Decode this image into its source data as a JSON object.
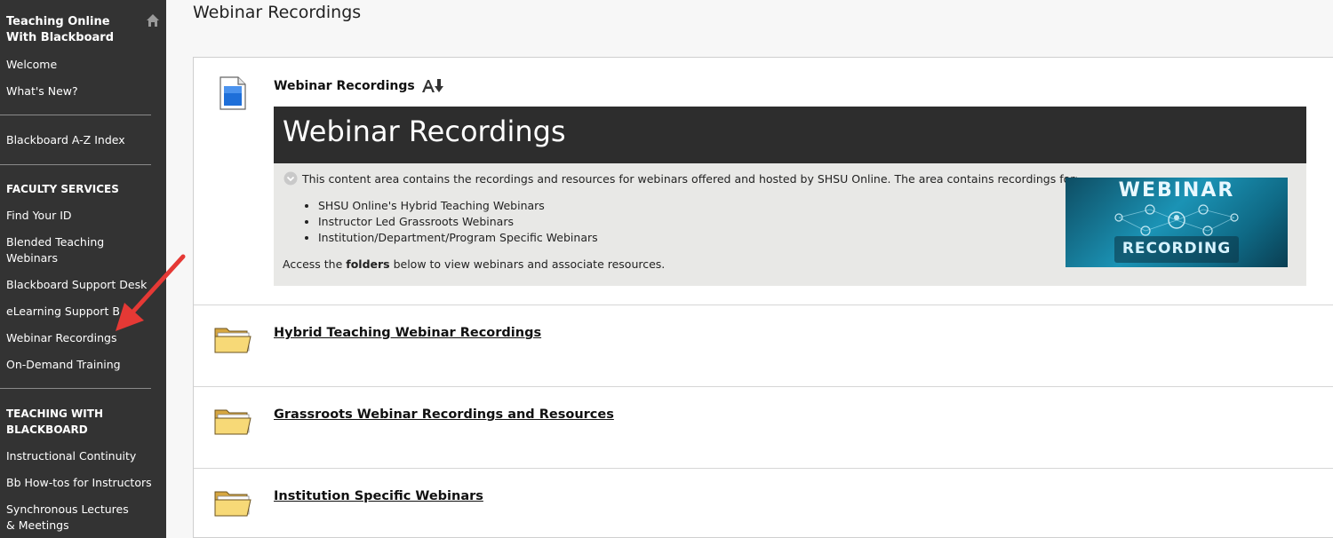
{
  "sidebar": {
    "course_title": "Teaching Online With Blackboard",
    "items_top": [
      "Welcome",
      "What's New?"
    ],
    "item_az": "Blackboard A-Z Index",
    "heading_faculty": "FACULTY SERVICES",
    "faculty_items": [
      "Find Your ID",
      "Blended Teaching Webinars",
      "Blackboard Support Desk",
      "eLearning Support B",
      "Webinar Recordings",
      "On-Demand Training"
    ],
    "heading_teaching": "TEACHING WITH BLACKBOARD",
    "teaching_items": [
      "Instructional Continuity",
      "Bb How-tos for Instructors",
      "Synchronous Lectures & Meetings"
    ]
  },
  "main": {
    "page_title": "Webinar Recordings",
    "item": {
      "title": "Webinar Recordings",
      "banner_text": "Webinar Recordings",
      "intro": "This content area contains the recordings and resources for webinars offered and hosted by SHSU Online.  The area contains recordings for:",
      "bullets": [
        "SHSU Online's Hybrid Teaching Webinars",
        "Instructor Led Grassroots Webinars",
        "Institution/Department/Program Specific Webinars"
      ],
      "access_prefix": "Access the ",
      "access_bold": "folders",
      "access_suffix": " below to view webinars and associate resources.",
      "image_text_top": "WEBINAR",
      "image_text_bottom": "RECORDING"
    },
    "folders": [
      "Hybrid Teaching Webinar Recordings",
      "Grassroots Webinar Recordings and Resources",
      "Institution Specific Webinars"
    ]
  },
  "colors": {
    "sidebar_bg": "#333333",
    "banner_bg": "#2d2d2d",
    "annotation_arrow": "#e53935"
  }
}
